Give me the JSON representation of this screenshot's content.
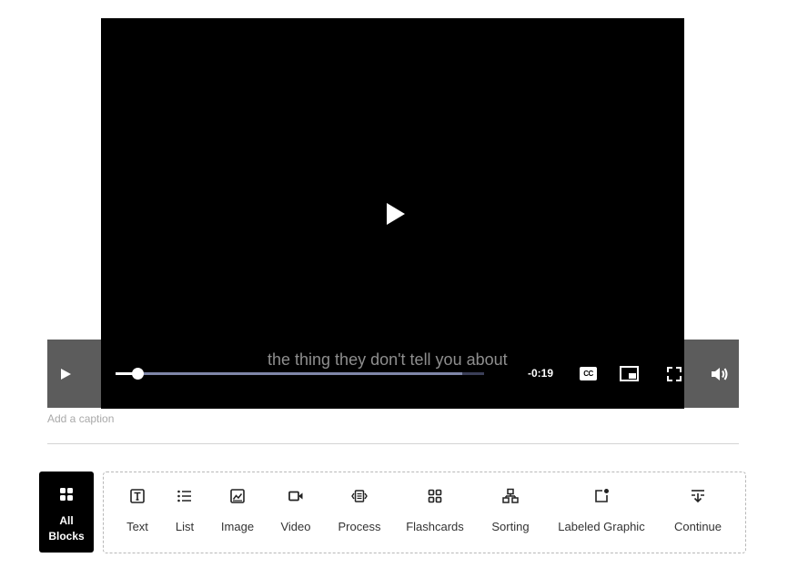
{
  "player": {
    "subtitle": "the thing they don't tell you about",
    "time_remaining": "-0:19",
    "played_fraction": 0.06,
    "buffered_fraction": 0.94,
    "cc_label": "CC",
    "icons": {
      "big_play": "play-icon",
      "play": "play-icon",
      "captions": "closed-captions-icon",
      "pip": "picture-in-picture-icon",
      "fullscreen": "fullscreen-icon",
      "volume": "volume-icon"
    }
  },
  "caption": {
    "placeholder": "Add a caption"
  },
  "block_menu": {
    "all_blocks": {
      "line1": "All",
      "line2": "Blocks",
      "icon": "grid-icon"
    },
    "items": [
      {
        "label": "Text",
        "icon": "text-icon"
      },
      {
        "label": "List",
        "icon": "list-icon"
      },
      {
        "label": "Image",
        "icon": "image-icon"
      },
      {
        "label": "Video",
        "icon": "video-icon"
      },
      {
        "label": "Process",
        "icon": "process-icon"
      },
      {
        "label": "Flashcards",
        "icon": "flashcards-icon"
      },
      {
        "label": "Sorting",
        "icon": "sorting-icon"
      },
      {
        "label": "Labeled Graphic",
        "icon": "labeled-graphic-icon"
      },
      {
        "label": "Continue",
        "icon": "continue-icon"
      }
    ]
  },
  "colors": {
    "video_bg": "#000000",
    "controlbar_bg": "#5c5c5c",
    "progress_track": "#3b3f58",
    "progress_buffer": "#7f86a8",
    "accent": "#000000"
  }
}
